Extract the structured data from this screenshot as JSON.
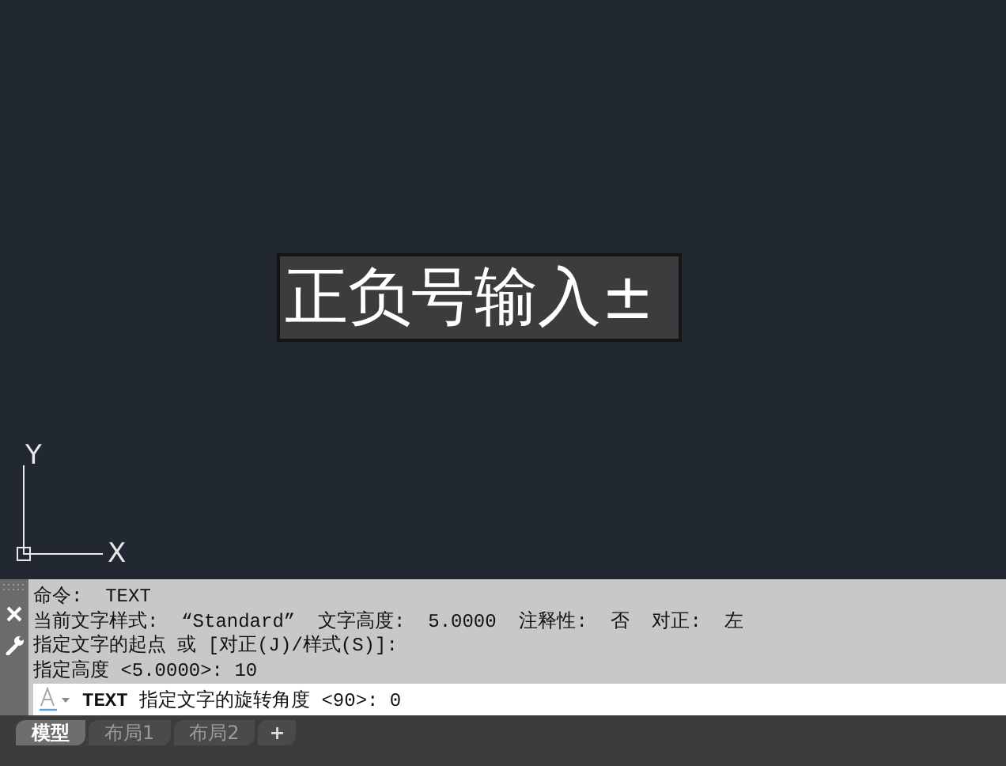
{
  "canvas": {
    "mtext": "正负号输入±",
    "ucs": {
      "x_label": "X",
      "y_label": "Y"
    }
  },
  "command_history": [
    "命令:  TEXT",
    "当前文字样式:  “Standard”  文字高度:  5.0000  注释性:  否  对正:  左",
    "指定文字的起点 或 [对正(J)/样式(S)]:",
    "指定高度 <5.0000>: 10"
  ],
  "command_line": {
    "prompt": "**TEXT** 指定文字的旋转角度 <90>: 0"
  },
  "layout_tabs": [
    {
      "label": "模型",
      "selected": true
    },
    {
      "label": "布局1",
      "selected": false
    },
    {
      "label": "布局2",
      "selected": false
    }
  ],
  "add_tab": "+"
}
